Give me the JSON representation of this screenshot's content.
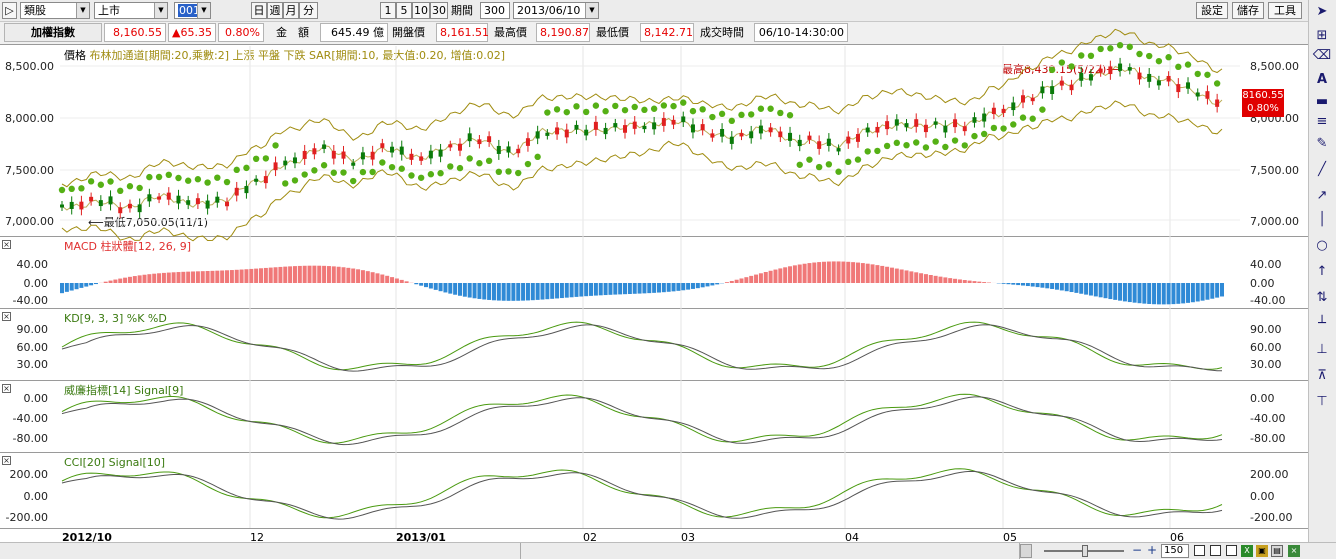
{
  "toolbar": {
    "category": "類股",
    "market": "上市",
    "code": "001",
    "periods": [
      "日",
      "週",
      "月",
      "分"
    ],
    "minute_options": [
      "1",
      "5",
      "10",
      "30"
    ],
    "period_count_label": "期間",
    "period_count": "300",
    "date": "2013/06/10",
    "right_buttons": [
      "設定",
      "儲存",
      "工具"
    ]
  },
  "quote": {
    "name": "加權指數",
    "price": "8,160.55",
    "change": "▲65.35",
    "change_pct": "0.80%",
    "amount_label": "金　額",
    "amount": "645.49 億",
    "open_label": "開盤價",
    "open": "8,161.51",
    "high_label": "最高價",
    "high": "8,190.87",
    "low_label": "最低價",
    "low": "8,142.71",
    "time_label": "成交時間",
    "time": "06/10-14:30:00"
  },
  "panels": {
    "price": {
      "title": "價格",
      "legend": "布林加通道[期間:20,乘數:2] 上漲  平盤  下跌 SAR[期間:10, 最大值:0.20, 增值:0.02]",
      "y_ticks": [
        "8,500.00",
        "8,000.00",
        "7,500.00",
        "7,000.00"
      ],
      "high_note": "最高8,439.15(5/22)",
      "low_note": "最低7,050.05(11/1)",
      "last_price": "8160.55",
      "last_pct": "0.80%"
    },
    "macd": {
      "title": "MACD 柱狀體[12, 26, 9]",
      "y_ticks": [
        "40.00",
        "0.00",
        "-40.00"
      ]
    },
    "kd": {
      "title": "KD[9, 3, 3] %K  %D",
      "y_ticks": [
        "90.00",
        "60.00",
        "30.00"
      ]
    },
    "williams": {
      "title": "威廉指標[14] Signal[9]",
      "y_ticks": [
        "0.00",
        "-40.00",
        "-80.00"
      ]
    },
    "cci": {
      "title": "CCI[20] Signal[10]",
      "y_ticks": [
        "200.00",
        "0.00",
        "-200.00"
      ]
    }
  },
  "x_axis": {
    "labels": [
      "2012/10",
      "12",
      "2013/01",
      "02",
      "03",
      "04",
      "05",
      "06"
    ]
  },
  "bottom": {
    "zoom": "150"
  },
  "right_tools": [
    "cursor-icon",
    "crosshair-icon",
    "eraser-icon",
    "text-icon",
    "hline-icon",
    "lines-icon",
    "pen-icon",
    "line-icon",
    "arrow-icon",
    "vline-icon",
    "fib-icon",
    "gann-icon",
    "circle-icon",
    "rect-icon",
    "up-arrow-icon",
    "colors-icon",
    "bars-icon",
    "bars-icon",
    "channel-icon",
    "channel-icon",
    "hline-icon"
  ],
  "colors": {
    "up": "#e02020",
    "down": "#0a7a0a",
    "sar": "#55b015",
    "band": "#a08c10",
    "macd_pos": "#f07878",
    "macd_neg": "#2f8ad6",
    "k": "#4a9a10",
    "d": "#555555"
  }
}
